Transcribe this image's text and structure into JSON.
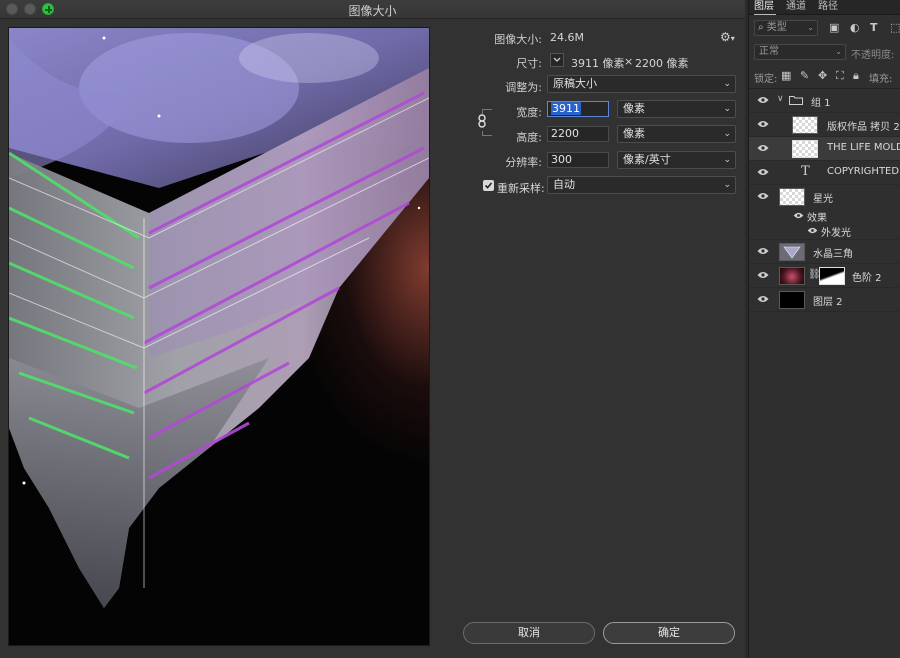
{
  "dialog": {
    "title": "图像大小",
    "image_size_label": "图像大小:",
    "image_size_value": "24.6M",
    "dimensions_label": "尺寸:",
    "dimensions_width": "3911 像素",
    "dimensions_sep": "×",
    "dimensions_height": "2200 像素",
    "fit_to_label": "调整为:",
    "fit_to_value": "原稿大小",
    "width_label": "宽度:",
    "width_value": "3911",
    "width_unit": "像素",
    "height_label": "高度:",
    "height_value": "2200",
    "height_unit": "像素",
    "resolution_label": "分辨率:",
    "resolution_value": "300",
    "resolution_unit": "像素/英寸",
    "resample_label": "重新采样:",
    "resample_checked": true,
    "resample_value": "自动",
    "cancel_label": "取消",
    "ok_label": "确定"
  },
  "layers_panel": {
    "tabs": [
      "图层",
      "通道",
      "路径"
    ],
    "filter_placeholder": "类型",
    "blend_mode": "正常",
    "opacity_label": "不透明度:",
    "lock_label": "锁定:",
    "fill_label": "填充:",
    "layers": [
      {
        "name": "组 1",
        "kind": "group"
      },
      {
        "name": "版权作品 拷贝 2",
        "kind": "pixel"
      },
      {
        "name": "THE LIFE MOLD I",
        "kind": "pixel",
        "selected": true
      },
      {
        "name": "COPYRIGHTED W",
        "kind": "text"
      },
      {
        "name": "星光",
        "kind": "pixel"
      },
      {
        "name": "效果",
        "kind": "effects"
      },
      {
        "name": "外发光",
        "kind": "effect"
      },
      {
        "name": "水晶三角",
        "kind": "pixel"
      },
      {
        "name": "色阶 2",
        "kind": "adjustment"
      },
      {
        "name": "图层 2",
        "kind": "pixel"
      }
    ]
  },
  "colors": {
    "accent_selection": "#2a62c9",
    "zoom_button": "#2ec445"
  }
}
